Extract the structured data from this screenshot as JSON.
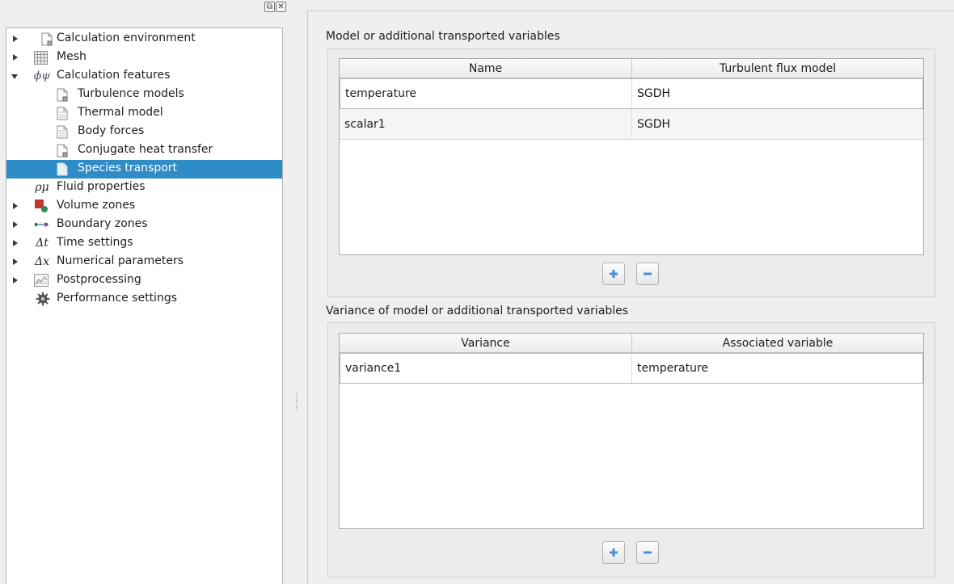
{
  "dock": {
    "float_icon": "float-icon",
    "close_icon": "close-icon"
  },
  "tree": {
    "items": [
      {
        "label": "Calculation environment",
        "icon": "document-icon",
        "arrow": "collapsed"
      },
      {
        "label": "Mesh",
        "icon": "grid-icon",
        "arrow": "collapsed"
      },
      {
        "label": "Calculation features",
        "icon": "phi-psi-icon",
        "icon_text": "ϕψ",
        "arrow": "expanded"
      },
      {
        "label": "Turbulence models",
        "icon": "document-icon"
      },
      {
        "label": "Thermal model",
        "icon": "document-icon"
      },
      {
        "label": "Body forces",
        "icon": "document-icon"
      },
      {
        "label": "Conjugate heat transfer",
        "icon": "document-icon"
      },
      {
        "label": "Species transport",
        "icon": "document-icon",
        "selected": true
      },
      {
        "label": "Fluid properties",
        "icon": "rho-mu-icon",
        "icon_text": "ρμ"
      },
      {
        "label": "Volume zones",
        "icon": "volume-zone-icon",
        "arrow": "collapsed"
      },
      {
        "label": "Boundary zones",
        "icon": "boundary-zone-icon",
        "arrow": "collapsed"
      },
      {
        "label": "Time settings",
        "icon": "delta-t-icon",
        "icon_text": "Δt",
        "arrow": "collapsed"
      },
      {
        "label": "Numerical parameters",
        "icon": "delta-x-icon",
        "icon_text": "Δx",
        "arrow": "collapsed"
      },
      {
        "label": "Postprocessing",
        "icon": "chart-icon",
        "arrow": "collapsed"
      },
      {
        "label": "Performance settings",
        "icon": "gear-icon"
      }
    ]
  },
  "variables": {
    "title": "Model or additional transported variables",
    "columns": [
      "Name",
      "Turbulent flux model"
    ],
    "rows": [
      [
        "temperature",
        "SGDH"
      ],
      [
        "scalar1",
        "SGDH"
      ]
    ]
  },
  "variances": {
    "title": "Variance of model or additional transported variables",
    "columns": [
      "Variance",
      "Associated variable"
    ],
    "rows": [
      [
        "variance1",
        "temperature"
      ]
    ]
  },
  "colors": {
    "selection": "#308cc6",
    "plus": "#4a90d9"
  }
}
